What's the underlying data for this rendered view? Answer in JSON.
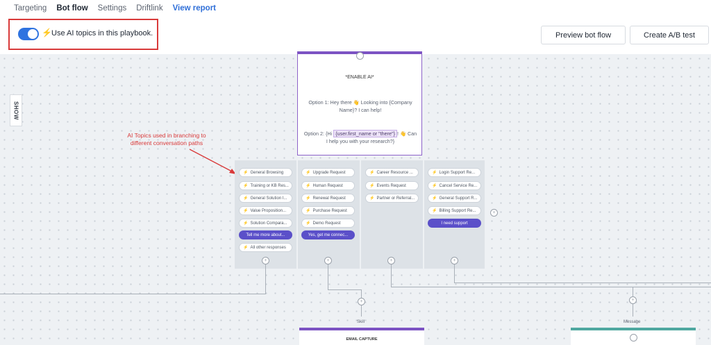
{
  "nav": {
    "tabs": [
      {
        "label": "Targeting"
      },
      {
        "label": "Bot flow"
      },
      {
        "label": "Settings"
      },
      {
        "label": "Driftlink"
      },
      {
        "label": "View report"
      }
    ]
  },
  "header": {
    "ai_toggle_label": "Use AI topics in this playbook.",
    "bolt": "⚡",
    "preview_button": "Preview bot flow",
    "abtest_button": "Create A/B test"
  },
  "canvas": {
    "show_label": "SHOW",
    "annotation": "AI Topics used in branching to different conversation paths",
    "top_card": {
      "title": "*ENABLE AI*",
      "option1": "Option 1: Hey there 👋 Looking into {Company Name}? I can help!",
      "option2_prefix": "Option 2: {Hi",
      "option2_var": "{user.first_name or \"there\"}",
      "option2_suffix": "! 👋 Can I help you with your research?}"
    },
    "columns": [
      {
        "chips": [
          "General Browsing",
          "Training or KB Res...",
          "General Solution I...",
          "Value Proposition...",
          "Solution Compara..."
        ],
        "purple": "Tell me more about...",
        "extra": "All other responses"
      },
      {
        "chips": [
          "Upgrade Request",
          "Human Request",
          "Renewal Request",
          "Purchase Request",
          "Demo Request"
        ],
        "purple": "Yes, get me connec..."
      },
      {
        "chips": [
          "Career Resource ...",
          "Events Request",
          "Partner or Referral..."
        ]
      },
      {
        "chips": [
          "Login Support Re...",
          "Cancel Service Re...",
          "General Support R...",
          "Billing Support Re..."
        ],
        "purple": "I need support"
      }
    ],
    "bottom": {
      "skill_label": "Skill",
      "skill_card_title": "EMAIL CAPTURE",
      "message_label": "Message"
    }
  }
}
